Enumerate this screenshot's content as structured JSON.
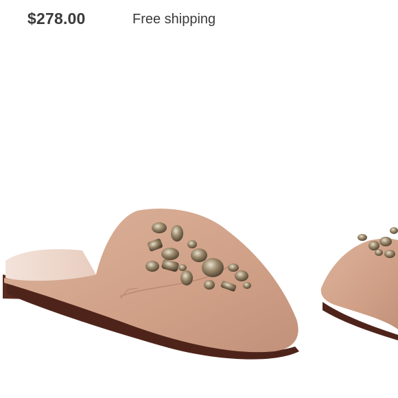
{
  "listing": {
    "price": "$278.00",
    "shipping": "Free shipping"
  },
  "gallery": {
    "main_image": "embellished-suede-mule-photo",
    "next_image": "embellished-suede-mule-photo-2"
  },
  "colors": {
    "suede": "#d2a38a",
    "sole": "#5a2a1e",
    "jewels": "#6b5a44"
  }
}
